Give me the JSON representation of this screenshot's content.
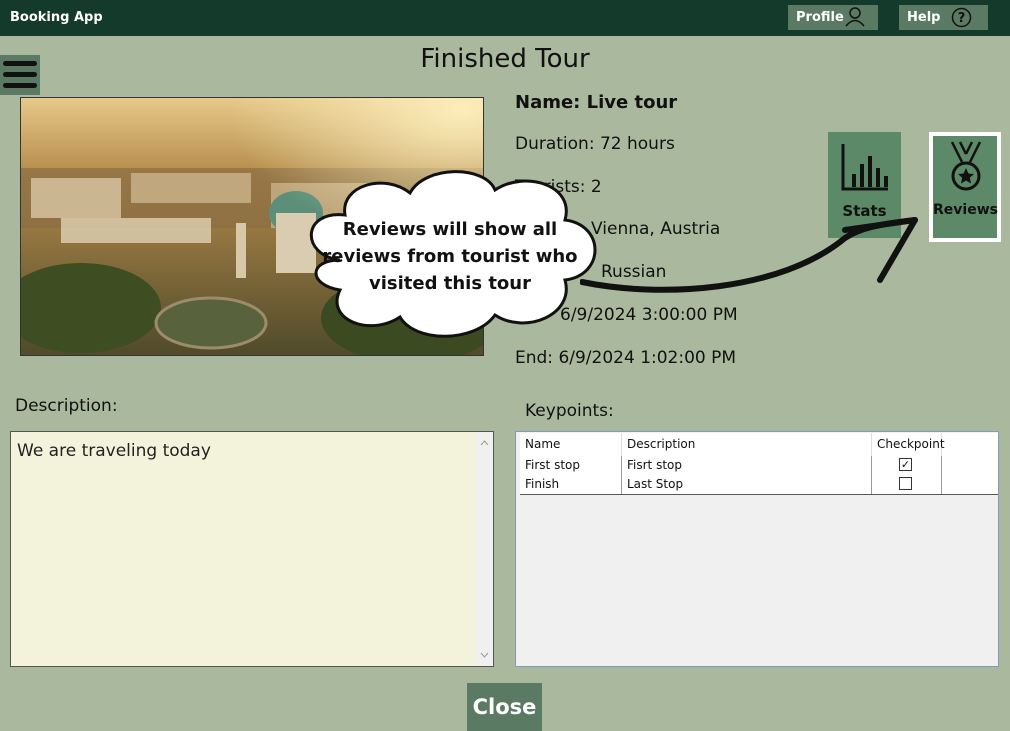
{
  "app": {
    "title": "Booking App"
  },
  "topbar": {
    "profile_label": "Profile",
    "help_label": "Help"
  },
  "page": {
    "title": "Finished Tour"
  },
  "tour": {
    "name": "Name: Live tour",
    "duration": "Duration: 72 hours",
    "tourists": "Tourists: 2",
    "location": "Vienna, Austria",
    "language": "Russian",
    "start": "6/9/2024 3:00:00 PM",
    "end": "End: 6/9/2024 1:02:00 PM"
  },
  "side_buttons": {
    "stats_label": "Stats",
    "reviews_label": "Reviews"
  },
  "description": {
    "label": "Description:",
    "text": "We are traveling today"
  },
  "keypoints": {
    "label": "Keypoints:",
    "columns": [
      "Name",
      "Description",
      "Checkpoint"
    ],
    "rows": [
      {
        "name": "First stop",
        "description": "Fisrt stop",
        "checkpoint": true
      },
      {
        "name": "Finish",
        "description": "Last Stop",
        "checkpoint": false
      }
    ]
  },
  "tooltip": {
    "line1": "Reviews will show all",
    "line2": "reviews from tourist who",
    "line3": "visited this tour"
  },
  "footer": {
    "close_label": "Close"
  },
  "colors": {
    "titlebar": "#143a2b",
    "background": "#aab99e",
    "button": "#5b7a63",
    "accent_button": "#5c8a68"
  }
}
